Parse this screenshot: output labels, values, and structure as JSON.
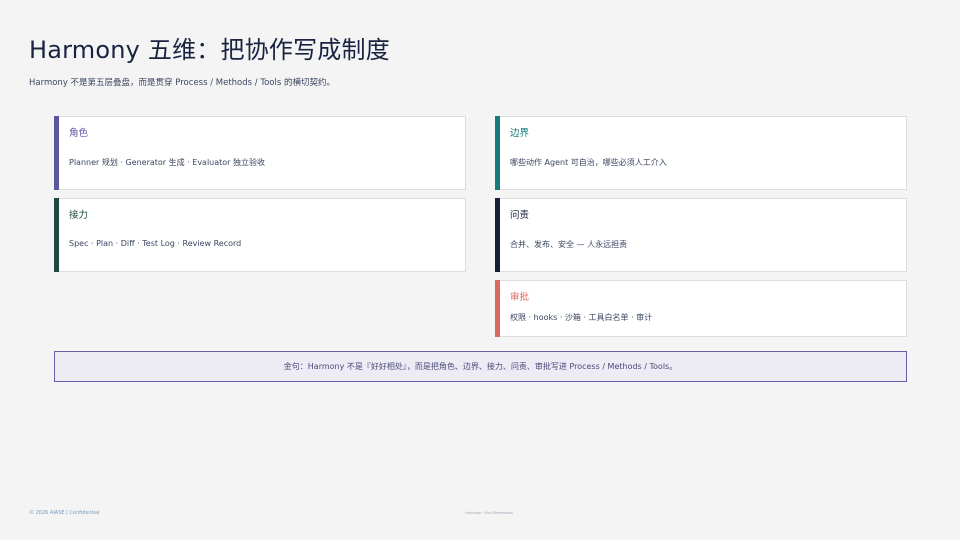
{
  "header": {
    "title": "Harmony 五维：把协作写成制度",
    "subtitle": "Harmony 不是第五层叠盘，而是贯穿 Process / Methods / Tools 的横切契约。"
  },
  "cards": [
    {
      "id": "role",
      "label": "角色",
      "body": "Planner 规划 · Generator 生成 · Evaluator 独立验收",
      "accent": "#5b56a0",
      "label_color": "#5b56a0"
    },
    {
      "id": "boundary",
      "label": "边界",
      "body": "哪些动作 Agent 可自治，哪些必须人工介入",
      "accent": "#137c7c",
      "label_color": "#137c7c"
    },
    {
      "id": "handoff",
      "label": "接力",
      "body": "Spec · Plan · Diff · Test Log · Review Record",
      "accent": "#1d4a40",
      "label_color": "#1d4a40"
    },
    {
      "id": "accountability",
      "label": "问责",
      "body": "合并、发布、安全 — 人永远担责",
      "accent": "#142038",
      "label_color": "#142038"
    },
    {
      "id": "approval",
      "label": "审批",
      "body": "权限 · hooks · 沙箱 · 工具白名单 · 审计",
      "accent": "#d9695f",
      "label_color": "#d9695f"
    }
  ],
  "quote": {
    "text": "金句：Harmony 不是『好好相处』，而是把角色、边界、接力、问责、审批写进 Process / Methods / Tools。"
  },
  "footer": {
    "left": "© 2026 AIASE  |  Confidential",
    "center": "Harmony · Five Dimensions"
  }
}
